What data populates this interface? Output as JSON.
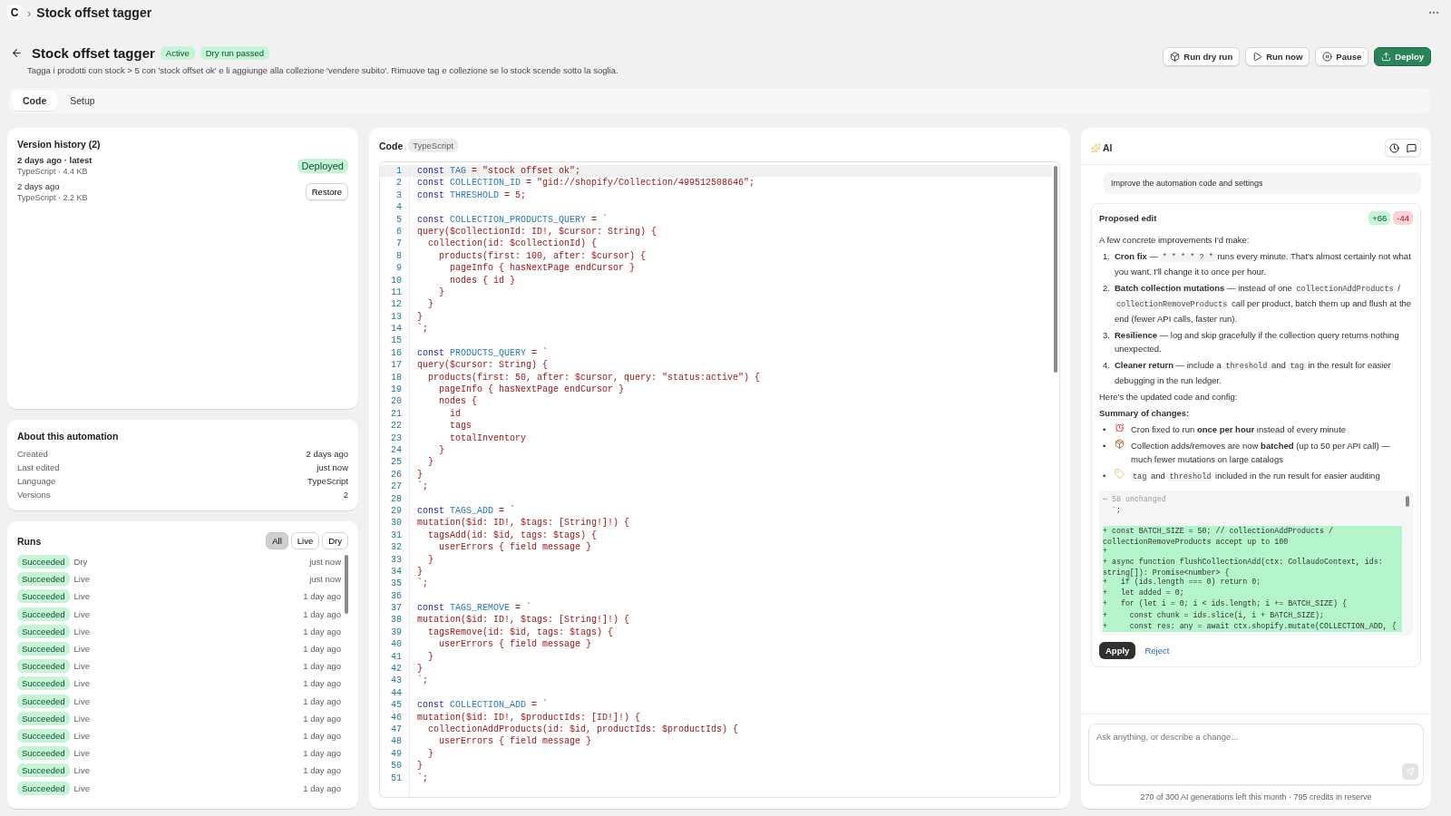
{
  "app": {
    "logo": "C",
    "separator": "›",
    "title": "Stock offset tagger"
  },
  "header": {
    "title": "Stock offset tagger",
    "badges": [
      "Active",
      "Dry run passed"
    ],
    "description": "Tagga i prodotti con stock > 5 con 'stock offset ok' e li aggiunge alla collezione 'vendere subito'. Rimuove tag e collezione se lo stock scende sotto la soglia.",
    "actions": [
      {
        "label": "Run dry run",
        "kind": "secondary"
      },
      {
        "label": "Run now",
        "kind": "secondary"
      },
      {
        "label": "Pause",
        "kind": "secondary"
      },
      {
        "label": "Deploy",
        "kind": "primary"
      }
    ]
  },
  "tabs": [
    {
      "label": "Code",
      "selected": true
    },
    {
      "label": "Setup",
      "selected": false
    }
  ],
  "version_history": {
    "title": "Version history (2)",
    "versions": [
      {
        "title": "2 days ago · latest",
        "meta": "TypeScript · 4.4 KB",
        "kind": "badge",
        "action": "Deployed"
      },
      {
        "title": "2 days ago",
        "meta": "TypeScript · 2.2 KB",
        "kind": "button",
        "action": "Restore"
      }
    ]
  },
  "about": {
    "title": "About this automation",
    "rows": [
      {
        "label": "Created",
        "value": "2 days ago"
      },
      {
        "label": "Last edited",
        "value": "just now"
      },
      {
        "label": "Language",
        "value": "TypeScript"
      },
      {
        "label": "Versions",
        "value": "2"
      }
    ]
  },
  "runs": {
    "title": "Runs",
    "filters": [
      {
        "label": "All",
        "selected": true
      },
      {
        "label": "Live",
        "selected": false
      },
      {
        "label": "Dry",
        "selected": false
      }
    ],
    "rows": [
      {
        "status": "Succeeded",
        "mode": "Dry",
        "time": "just now"
      },
      {
        "status": "Succeeded",
        "mode": "Live",
        "time": "just now"
      },
      {
        "status": "Succeeded",
        "mode": "Live",
        "time": "1 day ago"
      },
      {
        "status": "Succeeded",
        "mode": "Live",
        "time": "1 day ago"
      },
      {
        "status": "Succeeded",
        "mode": "Live",
        "time": "1 day ago"
      },
      {
        "status": "Succeeded",
        "mode": "Live",
        "time": "1 day ago"
      },
      {
        "status": "Succeeded",
        "mode": "Live",
        "time": "1 day ago"
      },
      {
        "status": "Succeeded",
        "mode": "Live",
        "time": "1 day ago"
      },
      {
        "status": "Succeeded",
        "mode": "Live",
        "time": "1 day ago"
      },
      {
        "status": "Succeeded",
        "mode": "Live",
        "time": "1 day ago"
      },
      {
        "status": "Succeeded",
        "mode": "Live",
        "time": "1 day ago"
      },
      {
        "status": "Succeeded",
        "mode": "Live",
        "time": "1 day ago"
      },
      {
        "status": "Succeeded",
        "mode": "Live",
        "time": "1 day ago"
      },
      {
        "status": "Succeeded",
        "mode": "Live",
        "time": "1 day ago"
      }
    ]
  },
  "code": {
    "title": "Code",
    "language": "TypeScript",
    "lines": [
      {
        "n": "1",
        "selected": true,
        "parts": [
          {
            "kind": "keyword",
            "text": "const"
          },
          {
            "kind": "name",
            "text": "TAG"
          },
          {
            "kind": "str",
            "text": "= \"stock offset ok\";"
          }
        ]
      },
      {
        "n": "2",
        "selected": false,
        "parts": [
          {
            "kind": "keyword",
            "text": "const"
          },
          {
            "kind": "name",
            "text": "COLLECTION_ID"
          },
          {
            "kind": "str",
            "text": "= \"gid://shopify/Collection/499512508646\";"
          }
        ]
      },
      {
        "n": "3",
        "selected": false,
        "parts": [
          {
            "kind": "keyword",
            "text": "const"
          },
          {
            "kind": "name",
            "text": "THRESHOLD"
          },
          {
            "kind": "str",
            "text": "= 5;"
          }
        ]
      },
      {
        "n": "4",
        "selected": false
      },
      {
        "n": "5",
        "selected": false,
        "parts": [
          {
            "kind": "keyword",
            "text": "const"
          },
          {
            "kind": "name",
            "text": "COLLECTION_PRODUCTS_QUERY"
          },
          {
            "kind": "str",
            "text": "= `"
          }
        ]
      },
      {
        "n": "6",
        "selected": false,
        "parts": [
          {
            "kind": "str",
            "text": "query($collectionId: ID!, $cursor: String) {"
          }
        ]
      },
      {
        "n": "7",
        "selected": false,
        "parts": [
          {
            "kind": "str",
            "text": "  collection(id: $collectionId) {"
          }
        ]
      },
      {
        "n": "8",
        "selected": false,
        "parts": [
          {
            "kind": "str",
            "text": "    products(first: 100, after: $cursor) {"
          }
        ]
      },
      {
        "n": "9",
        "selected": false,
        "parts": [
          {
            "kind": "str",
            "text": "      pageInfo { hasNextPage endCursor }"
          }
        ]
      },
      {
        "n": "10",
        "selected": false,
        "parts": [
          {
            "kind": "str",
            "text": "      nodes { id }"
          }
        ]
      },
      {
        "n": "11",
        "selected": false,
        "parts": [
          {
            "kind": "str",
            "text": "    }"
          }
        ]
      },
      {
        "n": "12",
        "selected": false,
        "parts": [
          {
            "kind": "str",
            "text": "  }"
          }
        ]
      },
      {
        "n": "13",
        "selected": false,
        "parts": [
          {
            "kind": "str",
            "text": "}"
          }
        ]
      },
      {
        "n": "14",
        "selected": false,
        "parts": [
          {
            "kind": "str",
            "text": "`;"
          }
        ]
      },
      {
        "n": "15",
        "selected": false
      },
      {
        "n": "16",
        "selected": false,
        "parts": [
          {
            "kind": "keyword",
            "text": "const"
          },
          {
            "kind": "name",
            "text": "PRODUCTS_QUERY"
          },
          {
            "kind": "str",
            "text": "= `"
          }
        ]
      },
      {
        "n": "17",
        "selected": false,
        "parts": [
          {
            "kind": "str",
            "text": "query($cursor: String) {"
          }
        ]
      },
      {
        "n": "18",
        "selected": false,
        "parts": [
          {
            "kind": "str",
            "text": "  products(first: 50, after: $cursor, query: \"status:active\") {"
          }
        ]
      },
      {
        "n": "19",
        "selected": false,
        "parts": [
          {
            "kind": "str",
            "text": "    pageInfo { hasNextPage endCursor }"
          }
        ]
      },
      {
        "n": "20",
        "selected": false,
        "parts": [
          {
            "kind": "str",
            "text": "    nodes {"
          }
        ]
      },
      {
        "n": "21",
        "selected": false,
        "parts": [
          {
            "kind": "str",
            "text": "      id"
          }
        ]
      },
      {
        "n": "22",
        "selected": false,
        "parts": [
          {
            "kind": "str",
            "text": "      tags"
          }
        ]
      },
      {
        "n": "23",
        "selected": false,
        "parts": [
          {
            "kind": "str",
            "text": "      totalInventory"
          }
        ]
      },
      {
        "n": "24",
        "selected": false,
        "parts": [
          {
            "kind": "str",
            "text": "    }"
          }
        ]
      },
      {
        "n": "25",
        "selected": false,
        "parts": [
          {
            "kind": "str",
            "text": "  }"
          }
        ]
      },
      {
        "n": "26",
        "selected": false,
        "parts": [
          {
            "kind": "str",
            "text": "}"
          }
        ]
      },
      {
        "n": "27",
        "selected": false,
        "parts": [
          {
            "kind": "str",
            "text": "`;"
          }
        ]
      },
      {
        "n": "28",
        "selected": false
      },
      {
        "n": "29",
        "selected": false,
        "parts": [
          {
            "kind": "keyword",
            "text": "const"
          },
          {
            "kind": "name",
            "text": "TAGS_ADD"
          },
          {
            "kind": "str",
            "text": "= `"
          }
        ]
      },
      {
        "n": "30",
        "selected": false,
        "parts": [
          {
            "kind": "str",
            "text": "mutation($id: ID!, $tags: [String!]!) {"
          }
        ]
      },
      {
        "n": "31",
        "selected": false,
        "parts": [
          {
            "kind": "str",
            "text": "  tagsAdd(id: $id, tags: $tags) {"
          }
        ]
      },
      {
        "n": "32",
        "selected": false,
        "parts": [
          {
            "kind": "str",
            "text": "    userErrors { field message }"
          }
        ]
      },
      {
        "n": "33",
        "selected": false,
        "parts": [
          {
            "kind": "str",
            "text": "  }"
          }
        ]
      },
      {
        "n": "34",
        "selected": false,
        "parts": [
          {
            "kind": "str",
            "text": "}"
          }
        ]
      },
      {
        "n": "35",
        "selected": false,
        "parts": [
          {
            "kind": "str",
            "text": "`;"
          }
        ]
      },
      {
        "n": "36",
        "selected": false
      },
      {
        "n": "37",
        "selected": false,
        "parts": [
          {
            "kind": "keyword",
            "text": "const"
          },
          {
            "kind": "name",
            "text": "TAGS_REMOVE"
          },
          {
            "kind": "str",
            "text": "= `"
          }
        ]
      },
      {
        "n": "38",
        "selected": false,
        "parts": [
          {
            "kind": "str",
            "text": "mutation($id: ID!, $tags: [String!]!) {"
          }
        ]
      },
      {
        "n": "39",
        "selected": false,
        "parts": [
          {
            "kind": "str",
            "text": "  tagsRemove(id: $id, tags: $tags) {"
          }
        ]
      },
      {
        "n": "40",
        "selected": false,
        "parts": [
          {
            "kind": "str",
            "text": "    userErrors { field message }"
          }
        ]
      },
      {
        "n": "41",
        "selected": false,
        "parts": [
          {
            "kind": "str",
            "text": "  }"
          }
        ]
      },
      {
        "n": "42",
        "selected": false,
        "parts": [
          {
            "kind": "str",
            "text": "}"
          }
        ]
      },
      {
        "n": "43",
        "selected": false,
        "parts": [
          {
            "kind": "str",
            "text": "`;"
          }
        ]
      },
      {
        "n": "44",
        "selected": false
      },
      {
        "n": "45",
        "selected": false,
        "parts": [
          {
            "kind": "keyword",
            "text": "const"
          },
          {
            "kind": "name",
            "text": "COLLECTION_ADD"
          },
          {
            "kind": "str",
            "text": "= `"
          }
        ]
      },
      {
        "n": "46",
        "selected": false,
        "parts": [
          {
            "kind": "str",
            "text": "mutation($id: ID!, $productIds: [ID!]!) {"
          }
        ]
      },
      {
        "n": "47",
        "selected": false,
        "parts": [
          {
            "kind": "str",
            "text": "  collectionAddProducts(id: $id, productIds: $productIds) {"
          }
        ]
      },
      {
        "n": "48",
        "selected": false,
        "parts": [
          {
            "kind": "str",
            "text": "    userErrors { field message }"
          }
        ]
      },
      {
        "n": "49",
        "selected": false,
        "parts": [
          {
            "kind": "str",
            "text": "  }"
          }
        ]
      },
      {
        "n": "50",
        "selected": false,
        "parts": [
          {
            "kind": "str",
            "text": "}"
          }
        ]
      },
      {
        "n": "51",
        "selected": false,
        "parts": [
          {
            "kind": "str",
            "text": "`;"
          }
        ]
      }
    ]
  },
  "ai": {
    "title": "AI",
    "prompt": "Improve the automation code and settings",
    "proposal": {
      "title": "Proposed edit",
      "added": "+66",
      "removed": "-44",
      "blocks": [
        {
          "kind": "paragraph",
          "parts": [
            {
              "kind": "text",
              "text": "A few concrete improvements I'd make:"
            }
          ]
        },
        {
          "kind": "numbered",
          "marker": "1.",
          "parts": [
            {
              "kind": "bold",
              "text": "Cron fix"
            },
            {
              "kind": "text",
              "text": " — "
            },
            {
              "kind": "code",
              "text": "* * * * ? *"
            },
            {
              "kind": "text",
              "text": " runs every minute. That's almost certainly not what you want. I'll change it to once per hour."
            }
          ]
        },
        {
          "kind": "numbered",
          "marker": "2.",
          "parts": [
            {
              "kind": "bold",
              "text": "Batch collection mutations"
            },
            {
              "kind": "text",
              "text": " — instead of one "
            },
            {
              "kind": "code",
              "text": "collectionAddProducts"
            },
            {
              "kind": "text",
              "text": " / "
            },
            {
              "kind": "code",
              "text": "collectionRemoveProducts"
            },
            {
              "kind": "text",
              "text": " call per product, batch them up and flush at the end (fewer API calls, faster run)."
            }
          ]
        },
        {
          "kind": "numbered",
          "marker": "3.",
          "parts": [
            {
              "kind": "bold",
              "text": "Resilience"
            },
            {
              "kind": "text",
              "text": " — log and skip gracefully if the collection query returns nothing unexpected."
            }
          ]
        },
        {
          "kind": "numbered",
          "marker": "4.",
          "parts": [
            {
              "kind": "bold",
              "text": "Cleaner return"
            },
            {
              "kind": "text",
              "text": " — include a "
            },
            {
              "kind": "code",
              "text": "threshold"
            },
            {
              "kind": "text",
              "text": " and "
            },
            {
              "kind": "code",
              "text": "tag"
            },
            {
              "kind": "text",
              "text": " in the result for easier debugging in the run ledger."
            }
          ]
        },
        {
          "kind": "paragraph",
          "parts": [
            {
              "kind": "text",
              "text": "Here's the updated code and config:"
            }
          ]
        },
        {
          "kind": "heading",
          "parts": [
            {
              "kind": "bold",
              "text": "Summary of changes:"
            }
          ]
        },
        {
          "kind": "bullet",
          "marker": "•",
          "parts": [
            {
              "kind": "text",
              "text": "Cron fixed to run "
            },
            {
              "kind": "bold",
              "text": "once per hour"
            },
            {
              "kind": "text",
              "text": " instead of every minute"
            }
          ]
        },
        {
          "kind": "bullet",
          "marker": "•",
          "parts": [
            {
              "kind": "text",
              "text": "Collection adds/removes are now "
            },
            {
              "kind": "bold",
              "text": "batched"
            },
            {
              "kind": "text",
              "text": " (up to 50 per API call) — much fewer mutations on large catalogs"
            }
          ]
        },
        {
          "kind": "bullet",
          "marker": "•",
          "parts": [
            {
              "kind": "code",
              "text": "tag"
            },
            {
              "kind": "text",
              "text": " and "
            },
            {
              "kind": "code",
              "text": "threshold"
            },
            {
              "kind": "text",
              "text": " included in the run result for easier auditing"
            }
          ]
        }
      ],
      "diff": {
        "summary": "⋯ 58 unchanged",
        "lines": [
          {
            "kind": "context",
            "text": "  `;"
          },
          {
            "kind": "context"
          },
          {
            "kind": "added",
            "text": "+ const BATCH_SIZE = 50; // collectionAddProducts / collectionRemoveProducts accept up to 100"
          },
          {
            "kind": "added",
            "text": "+"
          },
          {
            "kind": "added",
            "text": "+ async function flushCollectionAdd(ctx: CollaudoContext, ids: string[]): Promise<number> {"
          },
          {
            "kind": "added",
            "text": "+   if (ids.length === 0) return 0;"
          },
          {
            "kind": "added",
            "text": "+   let added = 0;"
          },
          {
            "kind": "added",
            "text": "+   for (let i = 0; i < ids.length; i += BATCH_SIZE) {"
          },
          {
            "kind": "added",
            "text": "+     const chunk = ids.slice(i, i + BATCH_SIZE);"
          },
          {
            "kind": "added",
            "text": "+     const res: any = await ctx.shopify.mutate(COLLECTION_ADD, {"
          }
        ]
      },
      "apply": "Apply",
      "reject": "Reject"
    },
    "input": {
      "placeholder": "Ask anything, or describe a change..."
    },
    "send": {
      "disabled": true
    },
    "quota": "270 of 300 AI generations left this month · 795 credits in reserve"
  }
}
